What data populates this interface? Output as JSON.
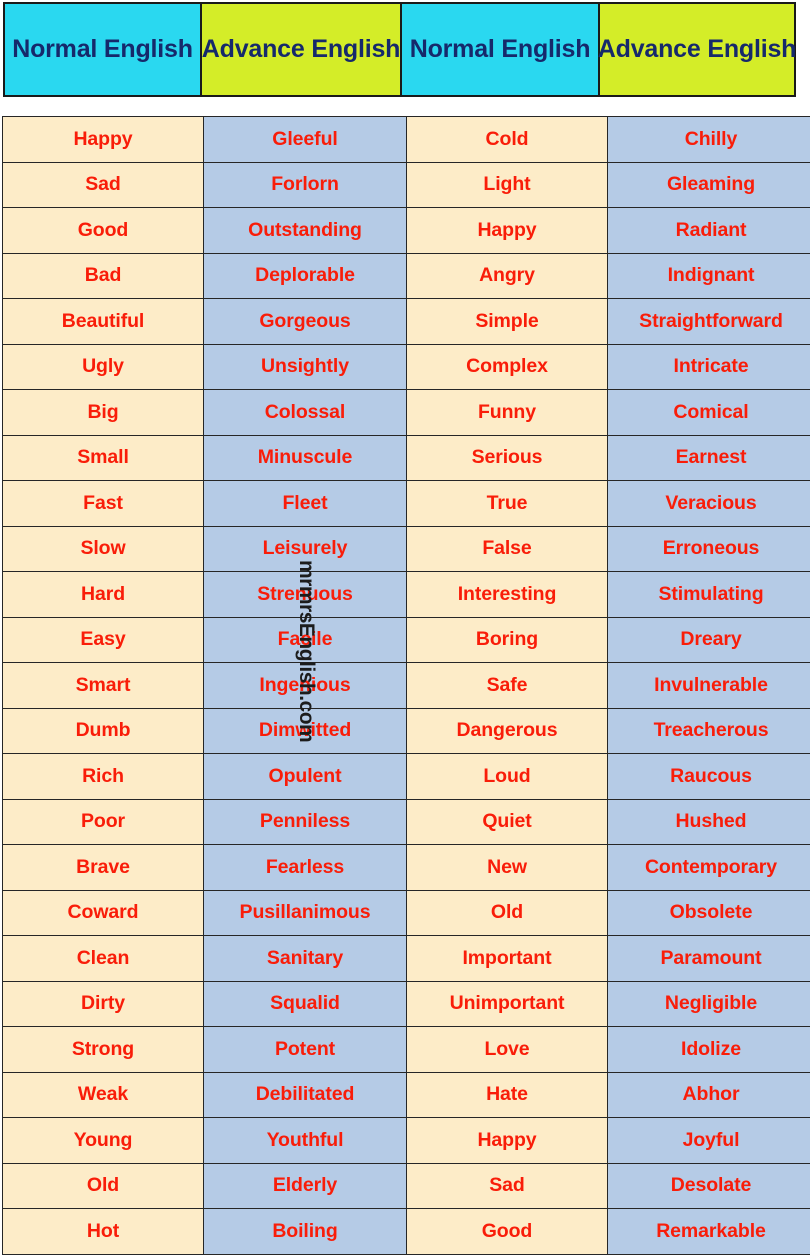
{
  "header": {
    "columns": [
      {
        "label": "Normal English",
        "bg": "#2ad8f0"
      },
      {
        "label": "Advance English",
        "bg": "#d4ed28"
      },
      {
        "label": "Normal English",
        "bg": "#2ad8f0"
      },
      {
        "label": "Advance English",
        "bg": "#d4ed28"
      }
    ],
    "text_color": "#16296b"
  },
  "watermark": {
    "text": "mrmrsEnglish.com"
  },
  "colors": {
    "normal_cell_bg": "#fdecc8",
    "advance_cell_bg": "#b5cbe6",
    "cell_text": "#f91d09",
    "border": "#262626",
    "page_bg": "#ffffff"
  },
  "table": {
    "rows": [
      {
        "left_normal": "Happy",
        "left_advance": "Gleeful",
        "right_normal": "Cold",
        "right_advance": "Chilly"
      },
      {
        "left_normal": "Sad",
        "left_advance": "Forlorn",
        "right_normal": "Light",
        "right_advance": "Gleaming"
      },
      {
        "left_normal": "Good",
        "left_advance": "Outstanding",
        "right_normal": "Happy",
        "right_advance": "Radiant"
      },
      {
        "left_normal": "Bad",
        "left_advance": "Deplorable",
        "right_normal": "Angry",
        "right_advance": "Indignant"
      },
      {
        "left_normal": "Beautiful",
        "left_advance": "Gorgeous",
        "right_normal": "Simple",
        "right_advance": "Straightforward"
      },
      {
        "left_normal": "Ugly",
        "left_advance": "Unsightly",
        "right_normal": "Complex",
        "right_advance": "Intricate"
      },
      {
        "left_normal": "Big",
        "left_advance": "Colossal",
        "right_normal": "Funny",
        "right_advance": "Comical"
      },
      {
        "left_normal": "Small",
        "left_advance": "Minuscule",
        "right_normal": "Serious",
        "right_advance": "Earnest"
      },
      {
        "left_normal": "Fast",
        "left_advance": "Fleet",
        "right_normal": "True",
        "right_advance": "Veracious"
      },
      {
        "left_normal": "Slow",
        "left_advance": "Leisurely",
        "right_normal": "False",
        "right_advance": "Erroneous"
      },
      {
        "left_normal": "Hard",
        "left_advance": "Strenuous",
        "right_normal": "Interesting",
        "right_advance": "Stimulating"
      },
      {
        "left_normal": "Easy",
        "left_advance": "Facile",
        "right_normal": "Boring",
        "right_advance": "Dreary"
      },
      {
        "left_normal": "Smart",
        "left_advance": "Ingenious",
        "right_normal": "Safe",
        "right_advance": "Invulnerable"
      },
      {
        "left_normal": "Dumb",
        "left_advance": "Dimwitted",
        "right_normal": "Dangerous",
        "right_advance": "Treacherous"
      },
      {
        "left_normal": "Rich",
        "left_advance": "Opulent",
        "right_normal": "Loud",
        "right_advance": "Raucous"
      },
      {
        "left_normal": "Poor",
        "left_advance": "Penniless",
        "right_normal": "Quiet",
        "right_advance": "Hushed"
      },
      {
        "left_normal": "Brave",
        "left_advance": "Fearless",
        "right_normal": "New",
        "right_advance": "Contemporary"
      },
      {
        "left_normal": "Coward",
        "left_advance": "Pusillanimous",
        "right_normal": "Old",
        "right_advance": "Obsolete"
      },
      {
        "left_normal": "Clean",
        "left_advance": "Sanitary",
        "right_normal": "Important",
        "right_advance": "Paramount"
      },
      {
        "left_normal": "Dirty",
        "left_advance": "Squalid",
        "right_normal": "Unimportant",
        "right_advance": "Negligible"
      },
      {
        "left_normal": "Strong",
        "left_advance": "Potent",
        "right_normal": "Love",
        "right_advance": "Idolize"
      },
      {
        "left_normal": "Weak",
        "left_advance": "Debilitated",
        "right_normal": "Hate",
        "right_advance": "Abhor"
      },
      {
        "left_normal": "Young",
        "left_advance": "Youthful",
        "right_normal": "Happy",
        "right_advance": "Joyful"
      },
      {
        "left_normal": "Old",
        "left_advance": "Elderly",
        "right_normal": "Sad",
        "right_advance": "Desolate"
      },
      {
        "left_normal": "Hot",
        "left_advance": "Boiling",
        "right_normal": "Good",
        "right_advance": "Remarkable"
      }
    ]
  }
}
